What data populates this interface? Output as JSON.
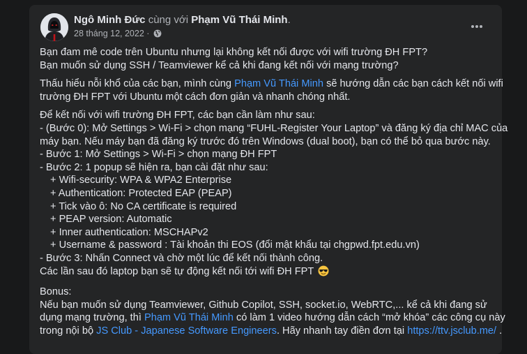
{
  "post": {
    "author": "Ngô Minh Đức",
    "with_text": "cùng với",
    "tagged": "Phạm Vũ Thái Minh",
    "period": ".",
    "date": "28 tháng 12, 2022",
    "dot": "·",
    "more_icon": "more-horizontal-icon",
    "audience_icon": "globe-icon"
  },
  "body": {
    "p1": {
      "l1": "Bạn đam mê code trên Ubuntu nhưng lại không kết nối được với wifi trường ĐH FPT?",
      "l2": "Bạn muốn sử dụng SSH / Teamviewer kể cả khi đang kết nối với mạng trường?"
    },
    "p2": {
      "l1_a": "Thấu hiểu nỗi khổ của các bạn, mình cùng",
      "l1_link": "Phạm Vũ Thái Minh",
      "l1_b": "sẽ hướng dẫn các bạn cách kết nối wifi",
      "l2": "trường ĐH FPT với Ubuntu một cách đơn giản và nhanh chóng nhất."
    },
    "p3": {
      "l1": "Để kết nối với wifi trường ĐH FPT, các bạn cần làm như sau:",
      "l2": "- (Bước 0): Mở Settings > Wi-Fi > chọn mạng “FUHL-Register Your Laptop” và đăng ký địa chỉ MAC của",
      "l3": "máy bạn. Nếu máy bạn đã đăng ký trước đó trên Windows (dual boot), bạn có thể bỏ qua bước này.",
      "l4": "- Bước 1: Mở Settings > Wi-Fi > chọn mạng ĐH FPT",
      "l5": "- Bước 2: 1 popup sẽ hiện ra, bạn cài đặt như sau:",
      "l6": "+  Wifi-security: WPA & WPA2 Enterprise",
      "l7": "+  Authentication: Protected EAP (PEAP)",
      "l8": "+ Tick vào ô: No CA certificate is required",
      "l9": "+ PEAP version: Automatic",
      "l10": "+ Inner authentication: MSCHAPv2",
      "l11": "+ Username & password : Tài khoản thi EOS (đổi mật khẩu tại chgpwd.fpt.edu.vn)",
      "l12": "- Bước 3: Nhấn Connect và chờ một lúc để kết nối thành công.",
      "l13": "Các lần sau đó laptop bạn sẽ tự động kết nối tới wifi ĐH FPT",
      "l13_emoji": "sunglasses-emoji"
    },
    "p4": {
      "l1": "Bonus:",
      "l2": "Nếu bạn muốn sử dụng Teamviewer, Github Copilot, SSH, socket.io, WebRTC,... kể cả khi đang sử",
      "l3_a": "dụng mạng trường, thì",
      "l3_link": "Phạm Vũ Thái Minh",
      "l3_b": "có làm 1 video hướng dẫn cách “mở khóa” các công cụ này",
      "l4_a": "trong nội bộ",
      "l4_link": "JS Club - Japanese Software Engineers",
      "l4_b": ". Hãy nhanh tay điền đơn tại",
      "l4_link2": "https://ttv.jsclub.me/",
      "l4_c": "."
    }
  },
  "colors": {
    "background": "#18191a",
    "card": "#242526",
    "text": "#e4e6eb",
    "muted": "#b0b3b8",
    "link": "#4599ff"
  }
}
